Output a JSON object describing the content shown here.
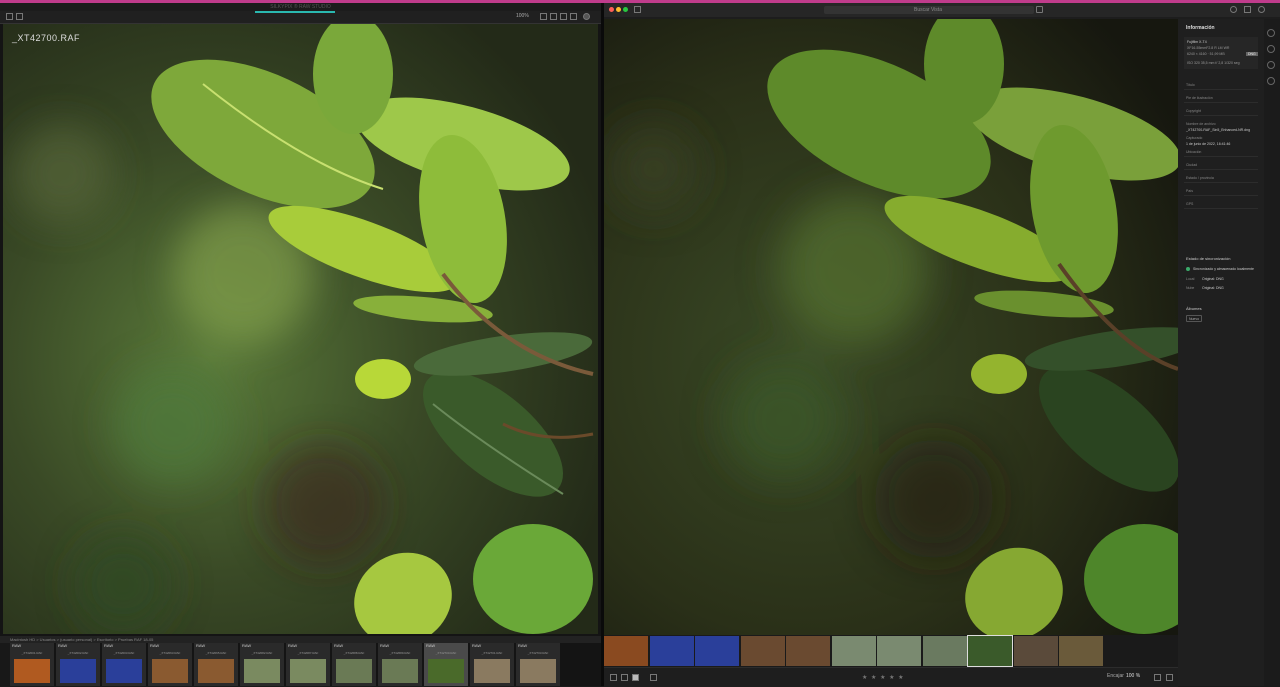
{
  "left_app": {
    "title": "SILKYPIX ® RAW STUDIO",
    "zoom": "100%",
    "filename": "_XT42700.RAF",
    "path": "Macintosh HD > Usuarios > (usuario personal) > Escritorio > Pruebas RAF 18-05",
    "thumbs": [
      {
        "tag": "RAW",
        "name": "_XT42001.RAF",
        "color": "#b05a20"
      },
      {
        "tag": "RAW",
        "name": "_XT42002.RAF",
        "color": "#2a3f9a"
      },
      {
        "tag": "RAW",
        "name": "_XT42003.RAF",
        "color": "#2a3f9a"
      },
      {
        "tag": "RAW",
        "name": "_XT42063.RAF",
        "color": "#8a5a30"
      },
      {
        "tag": "RAW",
        "name": "_XT42065.RAF",
        "color": "#8a5a30"
      },
      {
        "tag": "RAW",
        "name": "_XT42082.RAF",
        "color": "#7a8a60"
      },
      {
        "tag": "RAW",
        "name": "_XT42087.RAF",
        "color": "#7a8a60"
      },
      {
        "tag": "RAW",
        "name": "_XT42688.RAF",
        "color": "#6a7a55"
      },
      {
        "tag": "RAW",
        "name": "_XT42689.RAF",
        "color": "#6a7a55"
      },
      {
        "tag": "RAW",
        "name": "_XT42700.RAF",
        "color": "#4a6a2a"
      },
      {
        "tag": "RAW",
        "name": "_XT42701.RAF",
        "color": "#8a7a60"
      },
      {
        "tag": "RAW",
        "name": "_XT42703.RAF",
        "color": "#8a7a60"
      }
    ]
  },
  "right_app": {
    "search_placeholder": "Buscar Vista",
    "info": {
      "title": "Información",
      "camera": "Fujifilm X-T4",
      "lens": "XF16-55mmF2.8 R LM WR",
      "size": "6240 × 4160 · 51,99 MB",
      "badge": "DNG",
      "exif": "ISO 320   35,5 mm   f/ 2,8   1/320 seg",
      "fields": [
        {
          "label": "Título",
          "value": ""
        },
        {
          "label": "Pie de ilustración",
          "value": ""
        },
        {
          "label": "Copyright",
          "value": ""
        },
        {
          "label": "Nombre de archivo",
          "value": "_XT42700-RAF_Sin5_Enhanced-NR.dng"
        },
        {
          "label": "Capturado",
          "value": "1 de junio de 2022, 16:41:46"
        },
        {
          "label": "Ubicación",
          "value": ""
        },
        {
          "label": "Ciudad",
          "value": ""
        },
        {
          "label": "Estado / provincia",
          "value": ""
        },
        {
          "label": "País",
          "value": ""
        },
        {
          "label": "GPS",
          "value": ""
        }
      ],
      "sync_title": "Estado de sincronización",
      "sync_status": "Sincronizado y almacenado localmente",
      "local_label": "Local",
      "local_value": "Original: DNG",
      "cloud_label": "Nube",
      "cloud_value": "Original: DNG",
      "albums_title": "Álbumes",
      "album_button": "Nuevo"
    },
    "zoom_label": "Encajar",
    "zoom_value": "100 %",
    "stars": "★ ★ ★ ★ ★",
    "thumb_colors": [
      "#8a4a20",
      "#2a3f9a",
      "#2a3f9a",
      "#6a4a30",
      "#6a4a30",
      "#7a8a70",
      "#7a8a70",
      "#6a7a60",
      "#3a5a2a",
      "#5a4a3a",
      "#6a5a3a"
    ]
  }
}
